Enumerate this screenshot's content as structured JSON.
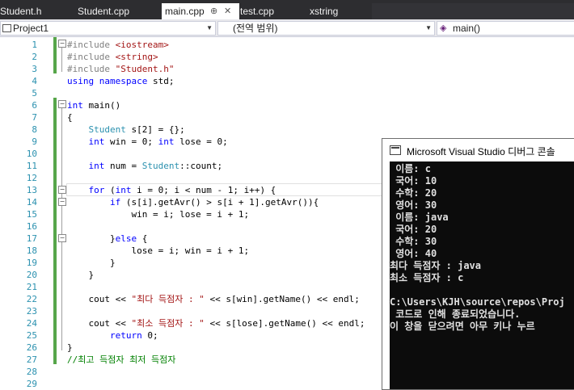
{
  "tabs": [
    {
      "label": "Student.h"
    },
    {
      "label": "Student.cpp"
    },
    {
      "label": "main.cpp",
      "active": true,
      "pin": "⊕",
      "close": "✕"
    },
    {
      "label": "test.cpp"
    },
    {
      "label": "xstring"
    }
  ],
  "navbar": {
    "project": "Project1",
    "scope": "(전역 범위)",
    "member": "main()"
  },
  "editor": {
    "line_numbers": [
      "1",
      "2",
      "3",
      "4",
      "5",
      "6",
      "7",
      "8",
      "9",
      "10",
      "11",
      "12",
      "13",
      "14",
      "15",
      "16",
      "17",
      "18",
      "19",
      "20",
      "21",
      "22",
      "23",
      "24",
      "25",
      "26",
      "27",
      "28",
      "29"
    ],
    "lines": [
      "#include <iostream>",
      "#include <string>",
      "#include \"Student.h\"",
      "using namespace std;",
      "",
      "int main()",
      "{",
      "    Student s[2] = {};",
      "    int win = 0; int lose = 0;",
      "",
      "    int num = Student::count;",
      "",
      "    for (int i = 0; i < num - 1; i++) {",
      "        if (s[i].getAvr() > s[i + 1].getAvr()){",
      "            win = i; lose = i + 1;",
      "",
      "        }else {",
      "            lose = i; win = i + 1;",
      "        }",
      "    }",
      "",
      "    cout << \"최다 득점자 : \" << s[win].getName() << endl;",
      "",
      "    cout << \"최소 득점자 : \" << s[lose].getName() << endl;",
      "        return 0;",
      "}",
      "//최고 득점자 최저 득점자",
      "",
      ""
    ]
  },
  "console": {
    "title": "Microsoft Visual Studio 디버그 콘솔",
    "lines": [
      " 이름: c",
      " 국어: 10",
      " 수학: 20",
      " 영어: 30",
      " 이름: java",
      " 국어: 20",
      " 수학: 30",
      " 영어: 40",
      "최다 득점자 : java",
      "최소 득점자 : c",
      "",
      "C:\\Users\\KJH\\source\\repos\\Proj",
      " 코드로 인해 종료되었습니다.",
      "이 창을 닫으려면 아무 키나 누르"
    ]
  }
}
